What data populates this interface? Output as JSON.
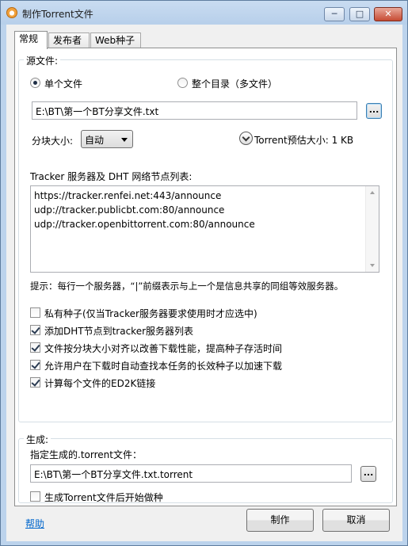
{
  "window": {
    "title": "制作Torrent文件",
    "minimize": "─",
    "maximize": "□",
    "close": "✕"
  },
  "tabs": [
    "常规",
    "发布者",
    "Web种子"
  ],
  "source": {
    "group_label": "源文件:",
    "single_file_label": "单个文件",
    "whole_dir_label": "整个目录（多文件）",
    "selected_mode": "single",
    "path_value": "E:\\BT\\第一个BT分享文件.txt",
    "browse_label": "...",
    "piece_size_label": "分块大小:",
    "piece_size_value": "自动",
    "estimate_label": "Torrent预估大小: 1 KB"
  },
  "trackers": {
    "label": "Tracker 服务器及 DHT 网络节点列表:",
    "lines": [
      "https://tracker.renfei.net:443/announce",
      "udp://tracker.publicbt.com:80/announce",
      "udp://tracker.openbittorrent.com:80/announce"
    ],
    "hint": "提示：每行一个服务器，“|”前缀表示与上一个是信息共享的同组等效服务器。"
  },
  "options": [
    {
      "label": "私有种子(仅当Tracker服务器要求使用时才应选中)",
      "checked": false
    },
    {
      "label": "添加DHT节点到tracker服务器列表",
      "checked": true
    },
    {
      "label": "文件按分块大小对齐以改善下载性能，提高种子存活时间",
      "checked": true
    },
    {
      "label": "允许用户在下载时自动查找本任务的长效种子以加速下载",
      "checked": true
    },
    {
      "label": "计算每个文件的ED2K链接",
      "checked": true
    }
  ],
  "output": {
    "group_label": "生成:",
    "field_label": "指定生成的.torrent文件：",
    "path_value": "E:\\BT\\第一个BT分享文件.txt.torrent",
    "browse_label": "...",
    "seed_after_label": "生成Torrent文件后开始做种",
    "seed_after_checked": false
  },
  "footer": {
    "help_label": "帮助",
    "create_label": "制作",
    "cancel_label": "取消"
  }
}
